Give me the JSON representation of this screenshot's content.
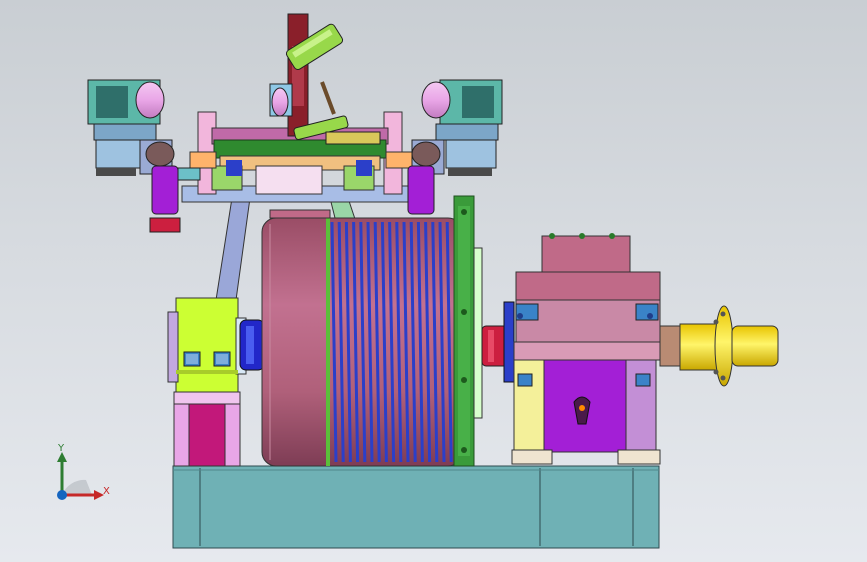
{
  "viewport": {
    "background_top": "#c9ced3",
    "background_bottom": "#e6e9ee"
  },
  "triad": {
    "x_label": "X",
    "y_label": "Y",
    "x_color": "#c62828",
    "y_color": "#2e7d32",
    "z_color": "#1565c0"
  },
  "model": {
    "parts": [
      "base-frame",
      "cable-drum",
      "rope-grooves",
      "drum-flange",
      "bearing-block",
      "gearbox",
      "output-coupling",
      "guide-arm",
      "top-frame",
      "pneumatic-cylinder",
      "left-motor",
      "right-motor"
    ],
    "colors": {
      "base": "#6fb1b5",
      "drum": "#b0607a",
      "rope": "#2b3fc9",
      "flange": "#3a9b3a",
      "bearing": "#ccff33",
      "gearbox_top": "#c06a88",
      "gearbox_body": "#a31fd6",
      "coupling": "#f2df00",
      "motor": "#e9a6e7"
    }
  }
}
